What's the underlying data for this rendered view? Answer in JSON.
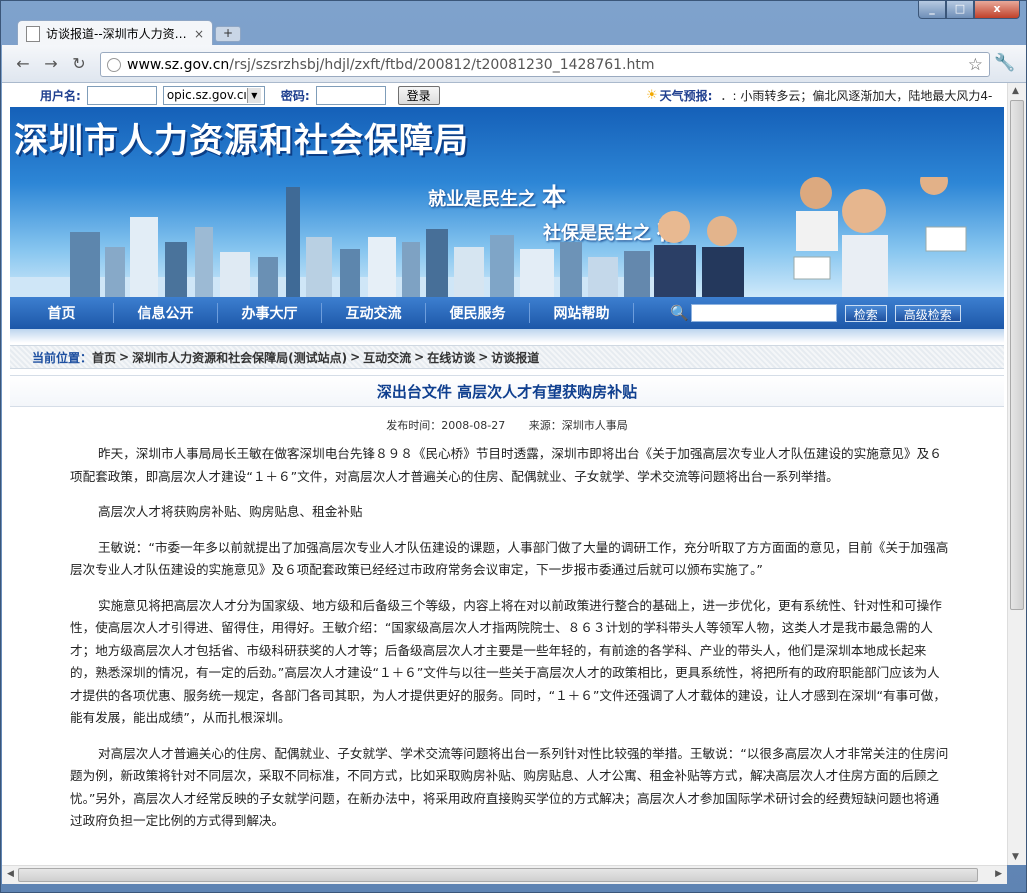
{
  "browser": {
    "tab_title": "访谈报道--深圳市人力资…",
    "tab_close": "×",
    "new_tab": "+",
    "url_host": "www.sz.gov.cn",
    "url_path": "/rsj/szsrzhsbj/hdjl/zxft/ftbd/200812/t20081230_1428761.htm",
    "back_icon": "←",
    "forward_icon": "→",
    "reload_icon": "↻",
    "star_icon": "☆",
    "wrench_icon": "🔧"
  },
  "login": {
    "username_label": "用户名:",
    "domain_value": "opic.sz.gov.cı",
    "password_label": "密码:",
    "login_button": "登录",
    "weather_label": "天气预报:",
    "weather_text": "．: 小雨转多云；偏北风逐渐加大，陆地最大风力4-"
  },
  "banner": {
    "site_title": "深圳市人力资源和社会保障局",
    "slogan1": "就业是民生之",
    "slogan1_big": "本",
    "slogan2": "社保是民生之",
    "slogan2_big": "福"
  },
  "nav": {
    "items": [
      "首页",
      "信息公开",
      "办事大厅",
      "互动交流",
      "便民服务",
      "网站帮助"
    ],
    "search_button": "检索",
    "advanced_search_button": "高级检索"
  },
  "breadcrumb": {
    "label": "当前位置：",
    "items": [
      "首页",
      "深圳市人力资源和社会保障局(测试站点)",
      "互动交流",
      "在线访谈",
      "访谈报道"
    ],
    "sep": ">"
  },
  "article": {
    "title": "深出台文件 高层次人才有望获购房补贴",
    "publish_time": "发布时间：2008-08-27",
    "source": "来源：深圳市人事局",
    "paragraphs": [
      "昨天，深圳市人事局局长王敏在做客深圳电台先锋８９８《民心桥》节目时透露，深圳市即将出台《关于加强高层次专业人才队伍建设的实施意见》及６项配套政策，即高层次人才建设“１＋６”文件，对高层次人才普遍关心的住房、配偶就业、子女就学、学术交流等问题将出台一系列举措。",
      "高层次人才将获购房补贴、购房贴息、租金补贴",
      "王敏说：“市委一年多以前就提出了加强高层次专业人才队伍建设的课题，人事部门做了大量的调研工作，充分听取了方方面面的意见，目前《关于加强高层次专业人才队伍建设的实施意见》及６项配套政策已经经过市政府常务会议审定，下一步报市委通过后就可以颁布实施了。”",
      "实施意见将把高层次人才分为国家级、地方级和后备级三个等级，内容上将在对以前政策进行整合的基础上，进一步优化，更有系统性、针对性和可操作性，使高层次人才引得进、留得住，用得好。王敏介绍：“国家级高层次人才指两院院士、８６３计划的学科带头人等领军人物，这类人才是我市最急需的人才；地方级高层次人才包括省、市级科研获奖的人才等；后备级高层次人才主要是一些年轻的，有前途的各学科、产业的带头人，他们是深圳本地成长起来的，熟悉深圳的情况，有一定的后劲。”高层次人才建设“１＋６”文件与以往一些关于高层次人才的政策相比，更具系统性，将把所有的政府职能部门应该为人才提供的各项优惠、服务统一规定，各部门各司其职，为人才提供更好的服务。同时，“１＋６”文件还强调了人才载体的建设，让人才感到在深圳“有事可做，能有发展，能出成绩”，从而扎根深圳。",
      "对高层次人才普遍关心的住房、配偶就业、子女就学、学术交流等问题将出台一系列针对性比较强的举措。王敏说：“以很多高层次人才非常关注的住房问题为例，新政策将针对不同层次，采取不同标准，不同方式，比如采取购房补贴、购房贴息、人才公寓、租金补贴等方式，解决高层次人才住房方面的后顾之忧。”另外，高层次人才经常反映的子女就学问题，在新办法中，将采用政府直接购买学位的方式解决；高层次人才参加国际学术研讨会的经费短缺问题也将通过政府负担一定比例的方式得到解决。"
    ]
  }
}
